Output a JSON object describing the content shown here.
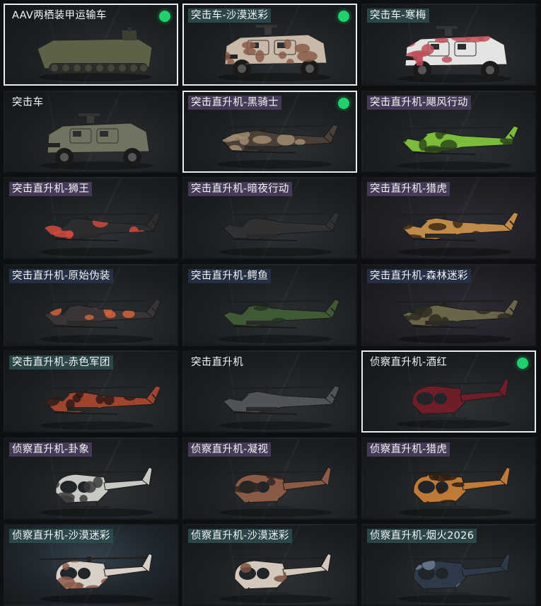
{
  "cards": [
    {
      "label": "AAV两栖装甲运输车",
      "vehicle": "amphibious-vehicle",
      "primary": "#5b6247",
      "accent": "#3c4030",
      "camo": "none",
      "label_style": "plain",
      "selected": true,
      "equipped": true
    },
    {
      "label": "突击车-沙漠迷彩",
      "vehicle": "armored-car",
      "primary": "#c9b9a8",
      "accent": "#8a5a4a",
      "camo": "desert",
      "label_style": "teal",
      "selected": true,
      "equipped": true
    },
    {
      "label": "突击车-寒梅",
      "vehicle": "armored-car",
      "primary": "#e4e4e2",
      "accent": "#c0505a",
      "camo": "plum",
      "label_style": "teal",
      "selected": false,
      "equipped": false
    },
    {
      "label": "突击车",
      "vehicle": "armored-car",
      "primary": "#6f735f",
      "accent": "#4a4e3e",
      "camo": "none",
      "label_style": "plain",
      "selected": false,
      "equipped": false
    },
    {
      "label": "突击直升机-黑骑士",
      "vehicle": "attack-helicopter",
      "primary": "#4a4038",
      "accent": "#a08a70",
      "camo": "dark",
      "label_style": "purple",
      "selected": true,
      "equipped": true
    },
    {
      "label": "突击直升机-飓风行动",
      "vehicle": "attack-helicopter",
      "primary": "#7bbd3a",
      "accent": "#2f4a1c",
      "camo": "green",
      "label_style": "purple",
      "selected": false,
      "equipped": false
    },
    {
      "label": "突击直升机-狮王",
      "vehicle": "attack-helicopter",
      "primary": "#2b2d2e",
      "accent": "#d24a3c",
      "camo": "lion",
      "label_style": "purple",
      "selected": false,
      "equipped": false
    },
    {
      "label": "突击直升机-暗夜行动",
      "vehicle": "attack-helicopter",
      "primary": "#2f3133",
      "accent": "#4a4c4e",
      "camo": "none",
      "label_style": "purple",
      "selected": false,
      "equipped": false
    },
    {
      "label": "突击直升机-猎虎",
      "vehicle": "attack-helicopter",
      "primary": "#c08a48",
      "accent": "#3e2a18",
      "camo": "tiger",
      "label_style": "purple",
      "selected": false,
      "equipped": false
    },
    {
      "label": "突击直升机-原始伪装",
      "vehicle": "attack-helicopter",
      "primary": "#3a3434",
      "accent": "#d0643c",
      "camo": "orange",
      "label_style": "navy",
      "selected": false,
      "equipped": false
    },
    {
      "label": "突击直升机-鳄鱼",
      "vehicle": "attack-helicopter",
      "primary": "#3f5a34",
      "accent": "#25331f",
      "camo": "croc",
      "label_style": "navy",
      "selected": false,
      "equipped": false
    },
    {
      "label": "突击直升机-森林迷彩",
      "vehicle": "attack-helicopter",
      "primary": "#6a6448",
      "accent": "#2e2c22",
      "camo": "forest",
      "label_style": "navy",
      "selected": false,
      "equipped": false
    },
    {
      "label": "突击直升机-赤色军团",
      "vehicle": "attack-helicopter",
      "primary": "#a0442e",
      "accent": "#2e1a16",
      "camo": "red",
      "label_style": "teal",
      "selected": false,
      "equipped": false
    },
    {
      "label": "突击直升机",
      "vehicle": "attack-helicopter",
      "primary": "#515456",
      "accent": "#3a3c3e",
      "camo": "none",
      "label_style": "plain",
      "selected": false,
      "equipped": false
    },
    {
      "label": "侦察直升机-酒红",
      "vehicle": "scout-helicopter",
      "primary": "#6e1e28",
      "accent": "#4a1218",
      "camo": "none",
      "label_style": "plain",
      "selected": true,
      "equipped": true
    },
    {
      "label": "侦察直升机-卦象",
      "vehicle": "scout-helicopter",
      "primary": "#c8c8c4",
      "accent": "#3a3a38",
      "camo": "pattern",
      "label_style": "purple",
      "selected": false,
      "equipped": false
    },
    {
      "label": "侦察直升机-凝视",
      "vehicle": "scout-helicopter",
      "primary": "#8a5a44",
      "accent": "#2e2622",
      "camo": "gaze",
      "label_style": "purple",
      "selected": false,
      "equipped": false
    },
    {
      "label": "侦察直升机-猎虎",
      "vehicle": "scout-helicopter",
      "primary": "#c07a38",
      "accent": "#2e1e12",
      "camo": "tiger",
      "label_style": "purple",
      "selected": false,
      "equipped": false
    },
    {
      "label": "侦察直升机-沙漠迷彩",
      "vehicle": "scout-helicopter",
      "primary": "#d8cfc6",
      "accent": "#8a5a4a",
      "camo": "desert",
      "label_style": "teal",
      "selected": false,
      "equipped": false
    },
    {
      "label": "侦察直升机-沙漠迷彩",
      "vehicle": "scout-helicopter",
      "primary": "#d4c8bc",
      "accent": "#7a5242",
      "camo": "desert",
      "label_style": "teal",
      "selected": false,
      "equipped": false
    },
    {
      "label": "侦察直升机-烟火2026",
      "vehicle": "scout-helicopter",
      "primary": "#2e3a4a",
      "accent": "#6a7c92",
      "camo": "fireworks",
      "label_style": "teal",
      "selected": false,
      "equipped": false
    }
  ]
}
